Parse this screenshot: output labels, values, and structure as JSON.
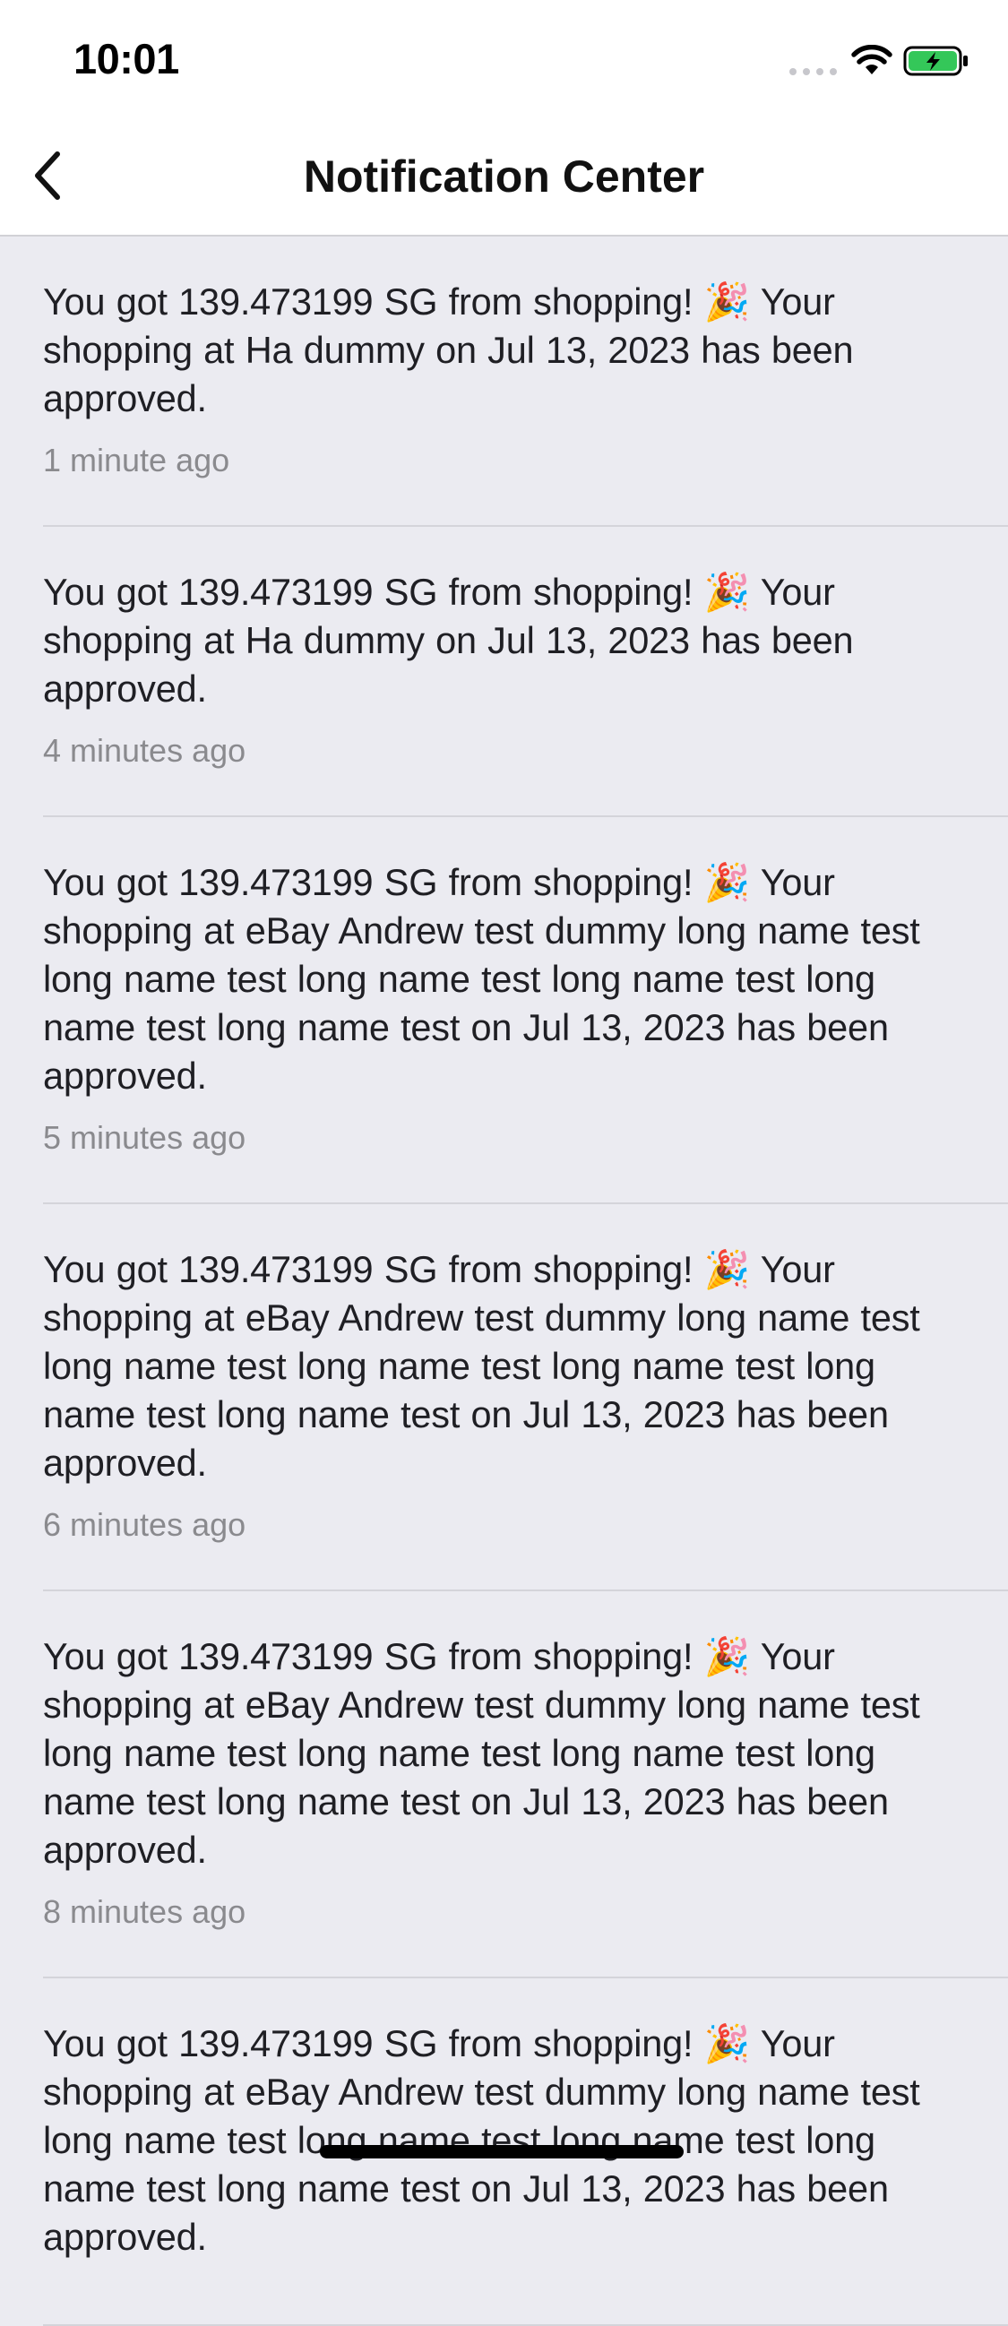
{
  "status_bar": {
    "time": "10:01",
    "icons": [
      "signal-icon",
      "wifi-icon",
      "battery-charging-icon"
    ]
  },
  "nav": {
    "back_icon": "chevron-left-icon",
    "title": "Notification Center"
  },
  "notifications": [
    {
      "message": "You got 139.473199 SG from shopping! 🎉 Your shopping at Ha dummy on Jul 13, 2023 has been approved.",
      "time": "1 minute ago"
    },
    {
      "message": "You got 139.473199 SG from shopping! 🎉 Your shopping at Ha dummy on Jul 13, 2023 has been approved.",
      "time": "4 minutes ago"
    },
    {
      "message": "You got 139.473199 SG from shopping! 🎉 Your shopping at eBay Andrew test dummy long name test long name test long name test long name test long name test long name test on Jul 13, 2023 has been approved.",
      "time": "5 minutes ago"
    },
    {
      "message": "You got 139.473199 SG from shopping! 🎉 Your shopping at eBay Andrew test dummy long name test long name test long name test long name test long name test long name test on Jul 13, 2023 has been approved.",
      "time": "6 minutes ago"
    },
    {
      "message": "You got 139.473199 SG from shopping! 🎉 Your shopping at eBay Andrew test dummy long name test long name test long name test long name test long name test long name test on Jul 13, 2023 has been approved.",
      "time": "8 minutes ago"
    },
    {
      "message": "You got 139.473199 SG from shopping! 🎉 Your shopping at eBay Andrew test dummy long name test long name test long name test long name test long name test long name test on Jul 13, 2023 has been approved.",
      "time": ""
    }
  ],
  "colors": {
    "background": "#ebebf1",
    "bar_background": "#ffffff",
    "timestamp": "#8a8a8e",
    "battery": "#34c759"
  }
}
